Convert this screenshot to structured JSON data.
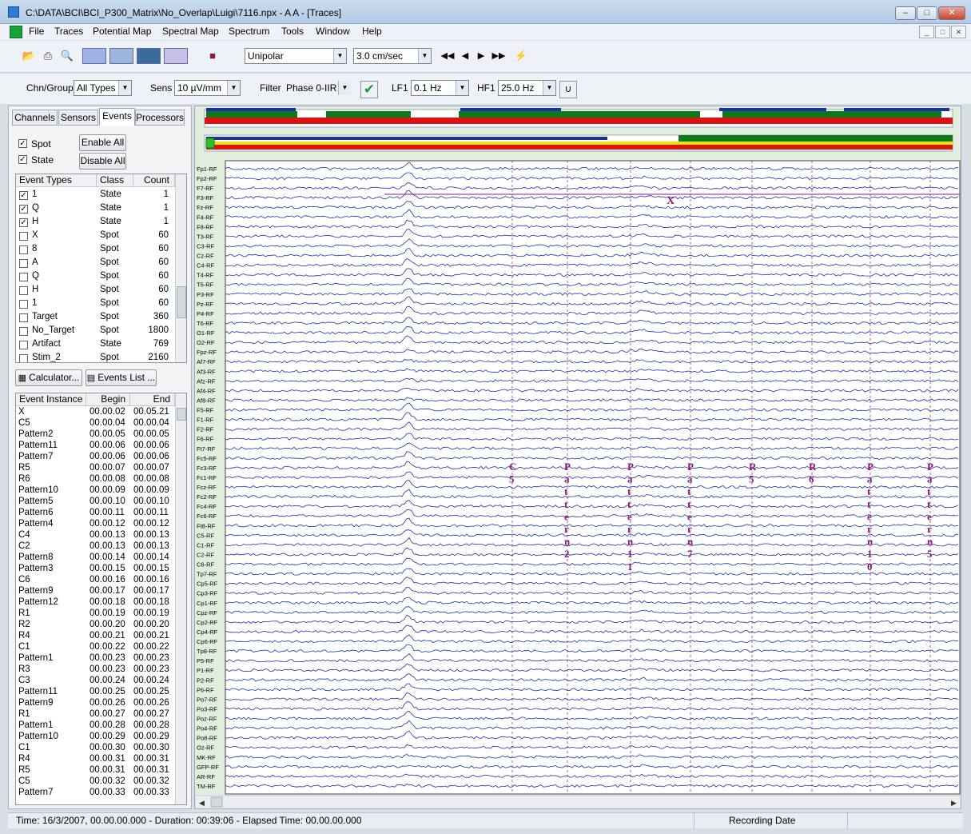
{
  "window": {
    "title": "C:\\DATA\\BCI\\BCI_P300_Matrix\\No_Overlap\\Luigi\\7116.npx - A A - [Traces]"
  },
  "menu": [
    "File",
    "Traces",
    "Potential Map",
    "Spectral Map",
    "Spectrum",
    "Tools",
    "Window",
    "Help"
  ],
  "toolbar": {
    "montage": "Unipolar",
    "speed": "3.0 cm/sec",
    "chn_group_label": "Chn/Group",
    "chn_group": "All Types",
    "sens_label": "Sens",
    "sens": "10 µV/mm",
    "filter_label": "Filter",
    "filter": "Phase 0-IIR",
    "lf1_label": "LF1",
    "lf1": "0.1 Hz",
    "hf1_label": "HF1",
    "hf1": "25.0 Hz"
  },
  "tabs": [
    "Channels",
    "Sensors",
    "Events",
    "Processors"
  ],
  "events_panel": {
    "spot_label": "Spot",
    "state_label": "State",
    "enable_all": "Enable All",
    "disable_all": "Disable All",
    "columns": [
      "Event Types",
      "Class",
      "Count"
    ],
    "types": [
      {
        "name": "1",
        "cls": "State",
        "count": "1",
        "checked": true
      },
      {
        "name": "Q",
        "cls": "State",
        "count": "1",
        "checked": true
      },
      {
        "name": "H",
        "cls": "State",
        "count": "1",
        "checked": true
      },
      {
        "name": "X",
        "cls": "Spot",
        "count": "60",
        "checked": false
      },
      {
        "name": "8",
        "cls": "Spot",
        "count": "60",
        "checked": false
      },
      {
        "name": "A",
        "cls": "Spot",
        "count": "60",
        "checked": false
      },
      {
        "name": "Q",
        "cls": "Spot",
        "count": "60",
        "checked": false
      },
      {
        "name": "H",
        "cls": "Spot",
        "count": "60",
        "checked": false
      },
      {
        "name": "1",
        "cls": "Spot",
        "count": "60",
        "checked": false
      },
      {
        "name": "Target",
        "cls": "Spot",
        "count": "360",
        "checked": false
      },
      {
        "name": "No_Target",
        "cls": "Spot",
        "count": "1800",
        "checked": false
      },
      {
        "name": "Artifact",
        "cls": "State",
        "count": "769",
        "checked": false
      },
      {
        "name": "Stim_2",
        "cls": "Spot",
        "count": "2160",
        "checked": false
      }
    ],
    "calculator": "Calculator...",
    "events_list": "Events List ...",
    "instance_columns": [
      "Event Instance",
      "Begin",
      "End"
    ],
    "instances": [
      [
        "X",
        "00.00.02",
        "00.05.21"
      ],
      [
        "C5",
        "00.00.04",
        "00.00.04"
      ],
      [
        "Pattern2",
        "00.00.05",
        "00.00.05"
      ],
      [
        "Pattern11",
        "00.00.06",
        "00.00.06"
      ],
      [
        "Pattern7",
        "00.00.06",
        "00.00.06"
      ],
      [
        "R5",
        "00.00.07",
        "00.00.07"
      ],
      [
        "R6",
        "00.00.08",
        "00.00.08"
      ],
      [
        "Pattern10",
        "00.00.09",
        "00.00.09"
      ],
      [
        "Pattern5",
        "00.00.10",
        "00.00.10"
      ],
      [
        "Pattern6",
        "00.00.11",
        "00.00.11"
      ],
      [
        "Pattern4",
        "00.00.12",
        "00.00.12"
      ],
      [
        "C4",
        "00.00.13",
        "00.00.13"
      ],
      [
        "C2",
        "00.00.13",
        "00.00.13"
      ],
      [
        "Pattern8",
        "00.00.14",
        "00.00.14"
      ],
      [
        "Pattern3",
        "00.00.15",
        "00.00.15"
      ],
      [
        "C6",
        "00.00.16",
        "00.00.16"
      ],
      [
        "Pattern9",
        "00.00.17",
        "00.00.17"
      ],
      [
        "Pattern12",
        "00.00.18",
        "00.00.18"
      ],
      [
        "R1",
        "00.00.19",
        "00.00.19"
      ],
      [
        "R2",
        "00.00.20",
        "00.00.20"
      ],
      [
        "R4",
        "00.00.21",
        "00.00.21"
      ],
      [
        "C1",
        "00.00.22",
        "00.00.22"
      ],
      [
        "Pattern1",
        "00.00.23",
        "00.00.23"
      ],
      [
        "R3",
        "00.00.23",
        "00.00.23"
      ],
      [
        "C3",
        "00.00.24",
        "00.00.24"
      ],
      [
        "Pattern11",
        "00.00.25",
        "00.00.25"
      ],
      [
        "Pattern9",
        "00.00.26",
        "00.00.26"
      ],
      [
        "R1",
        "00.00.27",
        "00.00.27"
      ],
      [
        "Pattern1",
        "00.00.28",
        "00.00.28"
      ],
      [
        "Pattern10",
        "00.00.29",
        "00.00.29"
      ],
      [
        "C1",
        "00.00.30",
        "00.00.30"
      ],
      [
        "R4",
        "00.00.31",
        "00.00.31"
      ],
      [
        "R5",
        "00.00.31",
        "00.00.31"
      ],
      [
        "C5",
        "00.00.32",
        "00.00.32"
      ],
      [
        "Pattern7",
        "00.00.33",
        "00.00.33"
      ]
    ]
  },
  "channels": [
    "Fp1-RF",
    "Fp2-RF",
    "F7-RF",
    "F3-RF",
    "Fz-RF",
    "F4-RF",
    "F8-RF",
    "T3-RF",
    "C3-RF",
    "Cz-RF",
    "C4-RF",
    "T4-RF",
    "T5-RF",
    "P3-RF",
    "Pz-RF",
    "P4-RF",
    "T6-RF",
    "O1-RF",
    "O2-RF",
    "Fpz-RF",
    "Af7-RF",
    "Af3-RF",
    "Afz-RF",
    "Af4-RF",
    "Af8-RF",
    "F5-RF",
    "F1-RF",
    "F2-RF",
    "F6-RF",
    "Ft7-RF",
    "Fc5-RF",
    "Fc3-RF",
    "Fc1-RF",
    "Fcz-RF",
    "Fc2-RF",
    "Fc4-RF",
    "Fc6-RF",
    "Ft8-RF",
    "C5-RF",
    "C1-RF",
    "C2-RF",
    "C6-RF",
    "Tp7-RF",
    "Cp5-RF",
    "Cp3-RF",
    "Cp1-RF",
    "Cpz-RF",
    "Cp2-RF",
    "Cp4-RF",
    "Cp6-RF",
    "Tp8-RF",
    "P5-RF",
    "P1-RF",
    "P2-RF",
    "P6-RF",
    "Po7-RF",
    "Po3-RF",
    "Poz-RF",
    "Po4-RF",
    "Po8-RF",
    "Oz-RF",
    "MK-RF",
    "GFP-RF",
    "AR-RF",
    "TM-RF"
  ],
  "trace_events": [
    "C5",
    "Pattern2",
    "Pattern11",
    "Pattern7",
    "R5",
    "R6",
    "Pattern10",
    "Pattern5"
  ],
  "state_marker": "X",
  "status": {
    "time": "Time: 16/3/2007, 00.00.00.000   - Duration: 00:39:06 - Elapsed Time: 00.00.00.000",
    "recording": "Recording Date"
  },
  "colors": {
    "trace": "#1a2fb0",
    "event": "#8b1a78",
    "accent_green": "#0a7a1a",
    "accent_red": "#e01010"
  }
}
